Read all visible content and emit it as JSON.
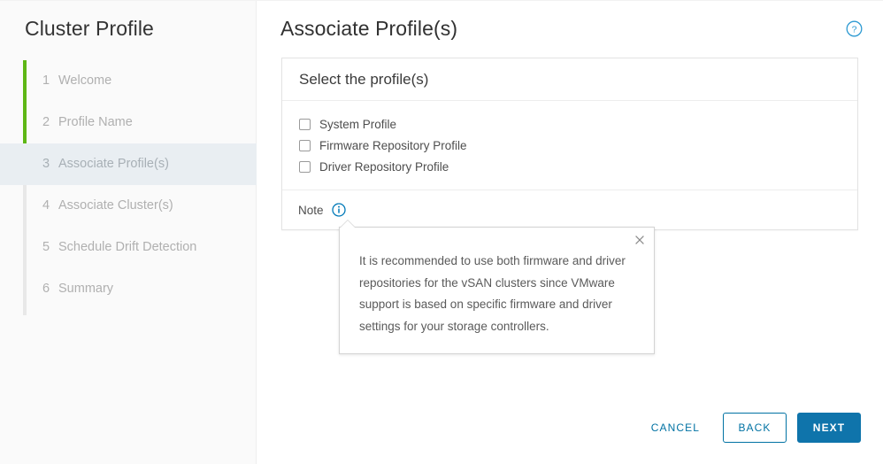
{
  "sidebar": {
    "title": "Cluster Profile",
    "progress_color": "#5eb715",
    "active_index": 2,
    "items": [
      {
        "num": "1",
        "label": "Welcome"
      },
      {
        "num": "2",
        "label": "Profile Name"
      },
      {
        "num": "3",
        "label": "Associate Profile(s)"
      },
      {
        "num": "4",
        "label": "Associate Cluster(s)"
      },
      {
        "num": "5",
        "label": "Schedule Drift Detection"
      },
      {
        "num": "6",
        "label": "Summary"
      }
    ]
  },
  "main": {
    "page_title": "Associate Profile(s)",
    "help_icon": "help-circle-icon"
  },
  "card": {
    "header": "Select the profile(s)",
    "checkboxes": [
      {
        "label": "System Profile",
        "checked": false
      },
      {
        "label": "Firmware Repository Profile",
        "checked": false
      },
      {
        "label": "Driver Repository Profile",
        "checked": false
      }
    ],
    "note_label": "Note",
    "note_icon": "info-circle-icon"
  },
  "tooltip": {
    "text": "It is recommended to use both firmware and driver repositories for the vSAN clusters since VMware support is based on specific firmware and driver settings for your storage controllers.",
    "close_icon": "close-icon"
  },
  "footer": {
    "cancel_label": "Cancel",
    "back_label": "Back",
    "next_label": "Next"
  },
  "colors": {
    "accent_blue": "#0072a3",
    "primary_blue": "#0f74ab",
    "progress_green": "#5eb715",
    "active_nav_bg": "#e9eef2"
  }
}
